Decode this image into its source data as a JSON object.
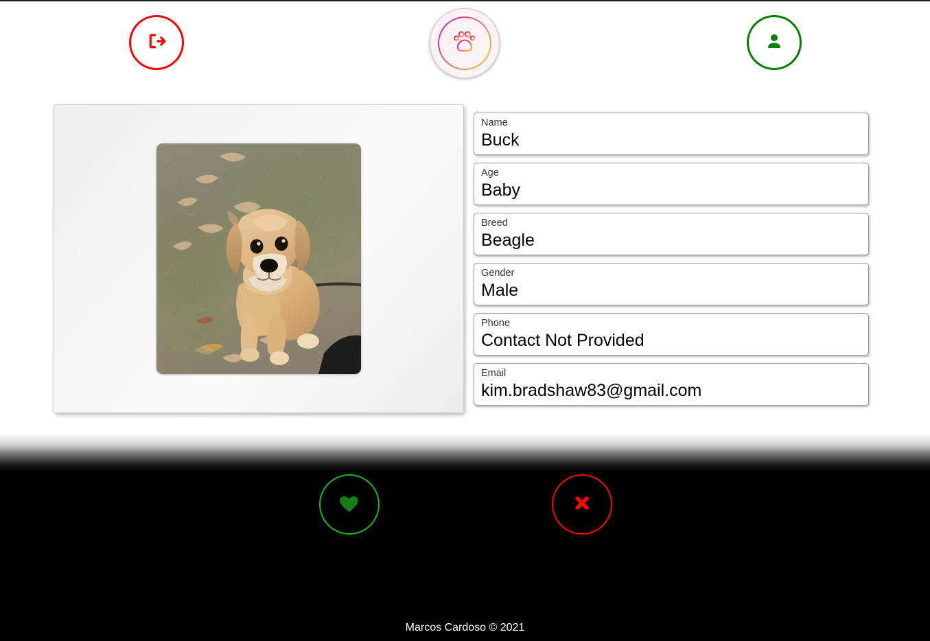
{
  "app": {
    "title": "Pet Adoption",
    "background_top": "#ffffff",
    "background_bottom": "#000000"
  },
  "header": {
    "logout_button": {
      "name": "Logout",
      "icon": "logout-icon",
      "color": "#ff0000"
    },
    "logo": {
      "name": "Paw Logo",
      "icon": "paw-icon",
      "gradient_start": "#cc1fb0",
      "gradient_end": "#eec13c",
      "background": "#fdf3f7"
    },
    "profile_button": {
      "name": "Profile",
      "icon": "person-icon",
      "color": "#008000"
    }
  },
  "pet": {
    "photo_alt": "Tan puppy sitting on grass with fallen leaves",
    "fields": [
      {
        "label": "Name",
        "value": "Buck"
      },
      {
        "label": "Age",
        "value": "Baby"
      },
      {
        "label": "Breed",
        "value": "Beagle"
      },
      {
        "label": "Gender",
        "value": "Male"
      },
      {
        "label": "Phone",
        "value": "Contact Not Provided"
      },
      {
        "label": "Email",
        "value": "kim.bradshaw83@gmail.com"
      }
    ]
  },
  "actions": {
    "like": {
      "name": "Like",
      "icon": "heart-icon",
      "icon_color": "#128012",
      "border_color": "#12b912"
    },
    "pass": {
      "name": "Pass",
      "icon": "close-x-icon",
      "icon_color": "#fc0606",
      "border_color": "#fc0606"
    }
  },
  "footer": {
    "credit": "Marcos Cardoso © 2021"
  }
}
